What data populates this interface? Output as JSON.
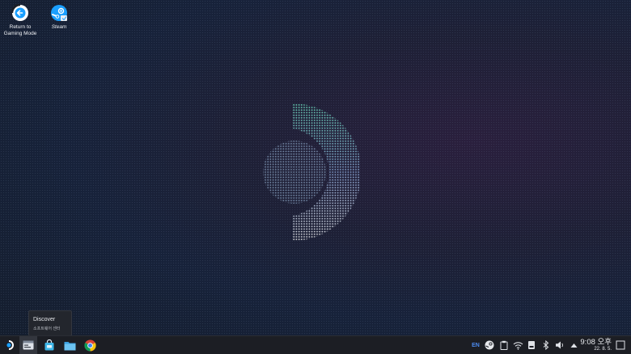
{
  "desktop": {
    "icons": [
      {
        "label": "Return to\nGaming Mode",
        "icon": "return-arrow-icon"
      },
      {
        "label": "Steam",
        "icon": "steam-icon"
      }
    ]
  },
  "tooltip": {
    "title": "Discover",
    "subtitle": "소프트웨어 센터"
  },
  "taskbar": {
    "apps": [
      "steamos-launcher-icon",
      "discover-icon",
      "store-bag-icon",
      "file-manager-icon",
      "chrome-icon"
    ],
    "tray": {
      "language": "EN",
      "icons": [
        "steam-tray-icon",
        "clipboard-icon",
        "wifi-icon",
        "storage-icon",
        "bluetooth-icon",
        "volume-icon",
        "expand-tray-icon"
      ]
    },
    "clock": {
      "time": "9:08 오후",
      "date": "22. 8. 5."
    },
    "show_desktop": "show-desktop-icon"
  },
  "colors": {
    "accent_blue": "#1a9fff",
    "tray_lang": "#4c8bf0",
    "taskbar_bg": "#1c1e24"
  }
}
